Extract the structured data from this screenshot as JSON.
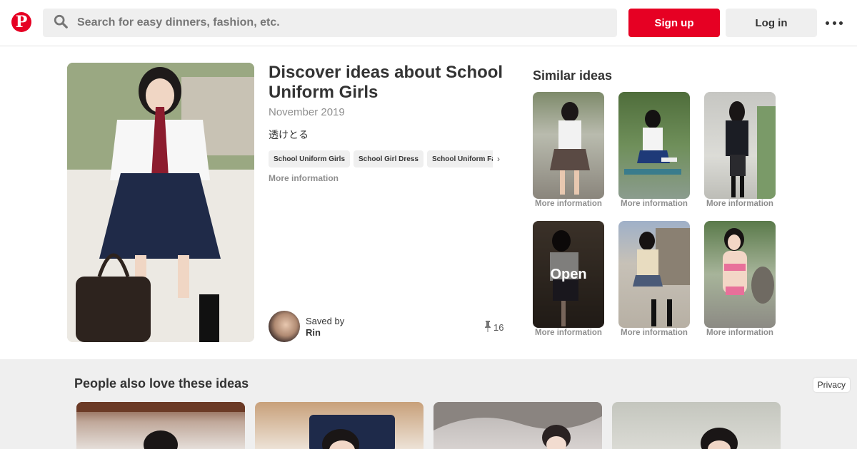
{
  "header": {
    "search_placeholder": "Search for easy dinners, fashion, etc.",
    "signup_label": "Sign up",
    "login_label": "Log in",
    "icons": {
      "logo": "pinterest-logo",
      "search": "search-icon",
      "more": "more-dots-icon"
    }
  },
  "pin": {
    "title": "Discover ideas about School Uniform Girls",
    "date": "November 2019",
    "description": "透けとる",
    "tags": [
      "School Uniform Girls",
      "School Girl Dress",
      "School Uniform Fashion"
    ],
    "more_info": "More information",
    "saved_by_label": "Saved by",
    "saved_by_name": "Rin",
    "pin_count": "16"
  },
  "similar": {
    "heading": "Similar ideas",
    "more_info": "More information",
    "open_label": "Open"
  },
  "people_also": {
    "heading": "People also love these ideas"
  },
  "privacy_label": "Privacy",
  "colors": {
    "brand": "#e60023",
    "button_gray": "#efefef",
    "muted_text": "#8e8e8e"
  }
}
